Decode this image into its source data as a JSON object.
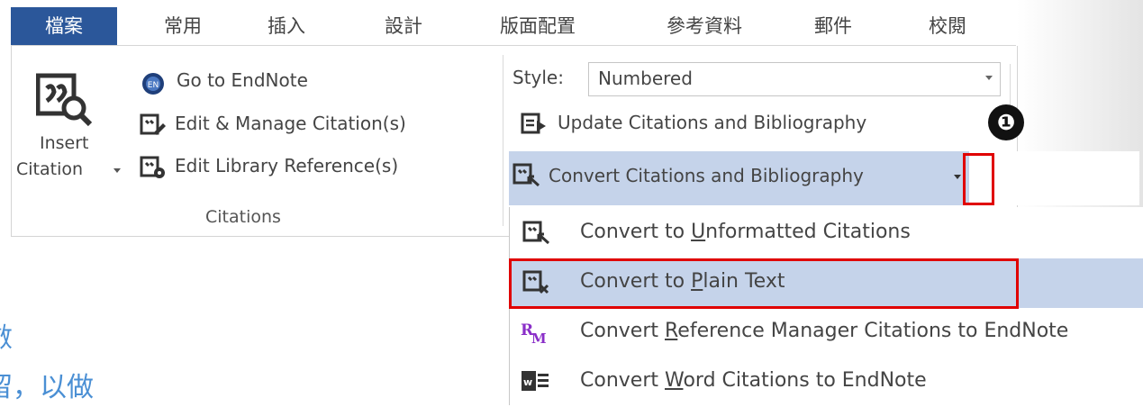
{
  "tabs": [
    "檔案",
    "常用",
    "插入",
    "設計",
    "版面配置",
    "參考資料",
    "郵件",
    "校閱"
  ],
  "citations_group": {
    "insert_line1": "Insert",
    "insert_line2": "Citation",
    "go_to_endnote": "Go to EndNote",
    "edit_manage": "Edit & Manage Citation(s)",
    "edit_library": "Edit Library Reference(s)",
    "group_label": "Citations"
  },
  "bibliography": {
    "style_label": "Style:",
    "style_value": "Numbered",
    "update": "Update Citations and Bibliography",
    "convert": "Convert Citations and Bibliography"
  },
  "step_marker": "❶",
  "menu": {
    "unformatted": {
      "pre": "Convert to ",
      "ul": "U",
      "post": "nformatted Citations"
    },
    "plain_text": {
      "pre": "Convert to ",
      "ul": "P",
      "post": "lain Text"
    },
    "ref_manager": {
      "pre": "Convert ",
      "ul": "R",
      "post": "eference Manager Citations to EndNote"
    },
    "word": {
      "pre": "Convert ",
      "ul": "W",
      "post": "ord Citations to EndNote"
    }
  },
  "side_text": {
    "line1": "數",
    "line2": "留，以做"
  },
  "colors": {
    "file_tab": "#2b579a",
    "highlight": "#c5d3ea",
    "red_box": "#e00000",
    "side_text": "#4a8fd4"
  }
}
